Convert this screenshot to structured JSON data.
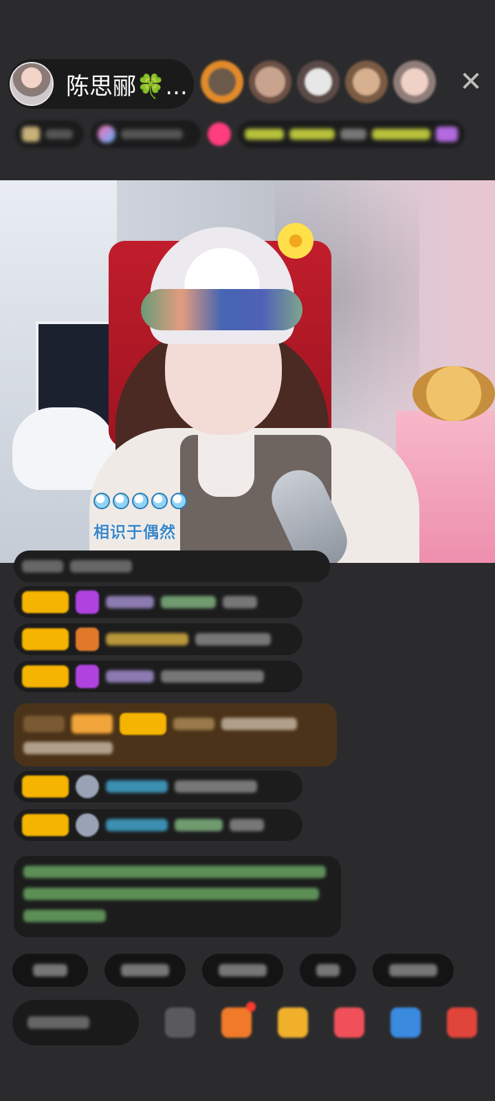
{
  "header": {
    "host_name": "陈思郦🍀...",
    "close_symbol": "✕"
  },
  "video": {
    "lyric_text": "相识于偶然",
    "progress_dots": 5
  },
  "colors": {
    "background": "#2b2b2d",
    "pill": "#1a1a1b",
    "badge_gold": "#f5b400",
    "lyric_blue": "#3b86c8"
  },
  "icons": {
    "close": "close-icon",
    "gift": "gift-icon",
    "share": "share-icon"
  }
}
